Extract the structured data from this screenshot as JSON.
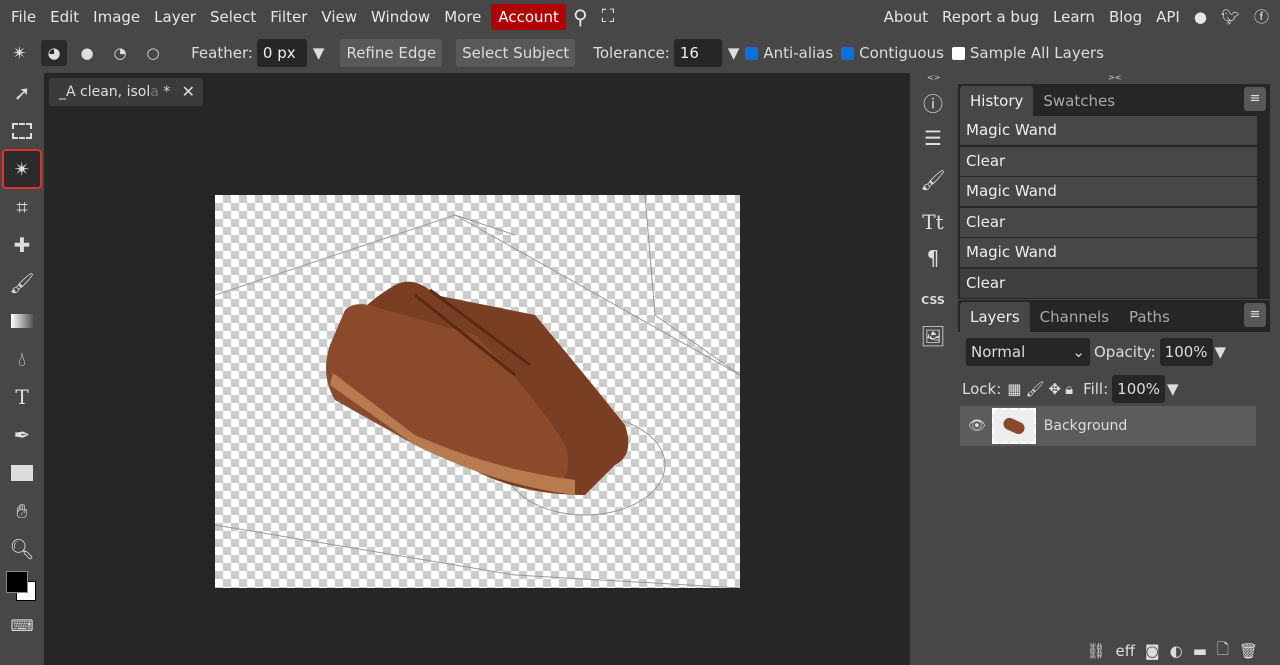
{
  "menubar": {
    "items": [
      "File",
      "Edit",
      "Image",
      "Layer",
      "Select",
      "Filter",
      "View",
      "Window",
      "More"
    ],
    "account": "Account",
    "right": [
      "About",
      "Report a bug",
      "Learn",
      "Blog",
      "API"
    ]
  },
  "options": {
    "feather_label": "Feather:",
    "feather_value": "0 px",
    "refine_edge": "Refine Edge",
    "select_subject": "Select Subject",
    "tolerance_label": "Tolerance:",
    "tolerance_value": "16",
    "anti_alias": "Anti-alias",
    "contiguous": "Contiguous",
    "sample_all": "Sample All Layers",
    "anti_alias_checked": true,
    "contiguous_checked": true,
    "sample_all_checked": false
  },
  "document": {
    "tab_title": "_A clean, isol",
    "tab_fade": "a",
    "tab_modified": " *",
    "close": "✕"
  },
  "strip": {
    "left": "<>",
    "right": "><"
  },
  "history": {
    "tabs": [
      "History",
      "Swatches"
    ],
    "items": [
      "Magic Wand",
      "Clear",
      "Magic Wand",
      "Clear",
      "Magic Wand",
      "Clear"
    ]
  },
  "layers": {
    "tabs": [
      "Layers",
      "Channels",
      "Paths"
    ],
    "blend_mode": "Normal",
    "opacity_label": "Opacity:",
    "opacity": "100%",
    "lock_label": "Lock:",
    "fill_label": "Fill:",
    "fill": "100%",
    "items": [
      {
        "name": "Background",
        "visible": true
      }
    ]
  },
  "colors": {
    "accent": "#b10000",
    "active_tool_outline": "#e23030",
    "checkbox": "#0f6fd6"
  },
  "icons": {
    "css": "CSS",
    "fx": "eff"
  }
}
